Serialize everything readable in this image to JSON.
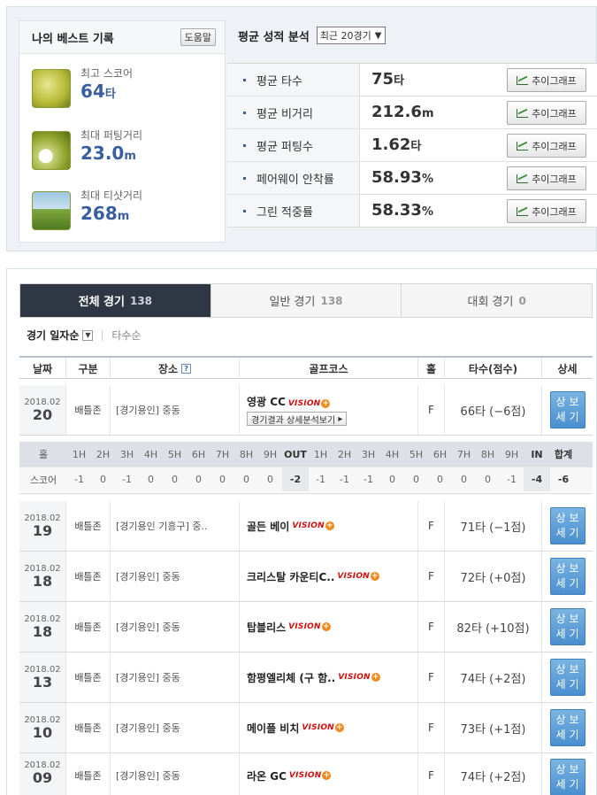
{
  "best": {
    "title": "나의 베스트 기록",
    "help_label": "도움말",
    "items": [
      {
        "label": "최고 스코어",
        "value": "64",
        "unit": "타",
        "icon": "ball-trophy-icon"
      },
      {
        "label": "최대 퍼팅거리",
        "value": "23.0",
        "unit": "m",
        "icon": "putting-icon"
      },
      {
        "label": "최대 티샷거리",
        "value": "268",
        "unit": "m",
        "icon": "teeshot-icon"
      }
    ]
  },
  "average": {
    "title": "평균 성적 분석",
    "period_selected": "최근 20경기",
    "trend_label": "추이그래프",
    "rows": [
      {
        "label": "평균 타수",
        "value": "75",
        "unit": "타"
      },
      {
        "label": "평균 비거리",
        "value": "212.6",
        "unit": "m"
      },
      {
        "label": "평균 퍼팅수",
        "value": "1.62",
        "unit": "타"
      },
      {
        "label": "페어웨이 안착률",
        "value": "58.93",
        "unit": "%"
      },
      {
        "label": "그린 적중률",
        "value": "58.33",
        "unit": "%"
      }
    ]
  },
  "tabs": [
    {
      "label": "전체 경기",
      "count": "138",
      "active": true
    },
    {
      "label": "일반 경기",
      "count": "138",
      "active": false
    },
    {
      "label": "대회 경기",
      "count": "0",
      "active": false
    }
  ],
  "sort": {
    "primary": "경기 일자순",
    "secondary": "타수순"
  },
  "columns": {
    "date": "날짜",
    "type": "구분",
    "place": "장소",
    "course": "골프코스",
    "hole": "홀",
    "score": "타수(점수)",
    "detail": "상세"
  },
  "vision_label": "VISION",
  "analysis_label": "경기결과 상세분석보기",
  "detail_label_1": "상세",
  "detail_label_2": "보기",
  "games": [
    {
      "ym": "2018.02",
      "day": "20",
      "type": "배틀존",
      "place": "[경기용인] 중동",
      "course": "영광 CC",
      "hole": "F",
      "score": "66타 (−6점)"
    },
    {
      "ym": "2018.02",
      "day": "19",
      "type": "배틀존",
      "place": "[경기용인 기흥구] 중..",
      "course": "골든 베이",
      "hole": "F",
      "score": "71타 (−1점)"
    },
    {
      "ym": "2018.02",
      "day": "18",
      "type": "배틀존",
      "place": "[경기용인] 중동",
      "course": "크리스탈 카운티C..",
      "hole": "F",
      "score": "72타 (+0점)"
    },
    {
      "ym": "2018.02",
      "day": "18",
      "type": "배틀존",
      "place": "[경기용인] 중동",
      "course": "탑블리스",
      "hole": "F",
      "score": "82타 (+10점)"
    },
    {
      "ym": "2018.02",
      "day": "13",
      "type": "배틀존",
      "place": "[경기용인] 중동",
      "course": "함평엘리체 (구 함..",
      "hole": "F",
      "score": "74타 (+2점)"
    },
    {
      "ym": "2018.02",
      "day": "10",
      "type": "배틀존",
      "place": "[경기용인] 중동",
      "course": "메이플 비치",
      "hole": "F",
      "score": "73타 (+1점)"
    },
    {
      "ym": "2018.02",
      "day": "09",
      "type": "배틀존",
      "place": "[경기용인] 중동",
      "course": "라온 GC",
      "hole": "F",
      "score": "74타 (+2점)"
    }
  ],
  "scorecard": {
    "hole_label": "홀",
    "score_label": "스코어",
    "holes": [
      "1H",
      "2H",
      "3H",
      "4H",
      "5H",
      "6H",
      "7H",
      "8H",
      "9H",
      "OUT",
      "1H",
      "2H",
      "3H",
      "4H",
      "5H",
      "6H",
      "7H",
      "8H",
      "9H",
      "IN",
      "합계"
    ],
    "scores": [
      "-1",
      "0",
      "-1",
      "0",
      "0",
      "0",
      "0",
      "0",
      "0",
      "-2",
      "-1",
      "-1",
      "-1",
      "0",
      "0",
      "0",
      "0",
      "0",
      "-1",
      "-4",
      "-6"
    ]
  }
}
